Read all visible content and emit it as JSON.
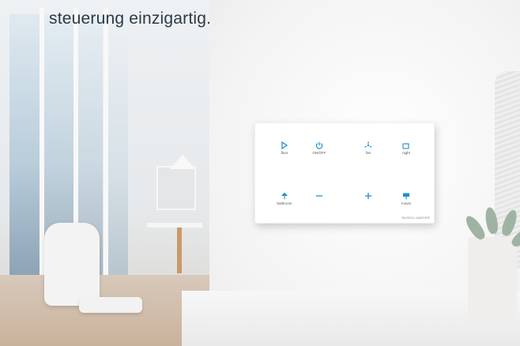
{
  "caption": {
    "line": "steuerung einzigartig."
  },
  "panel": {
    "brand": "BUSCH-JAEGER",
    "keys": [
      {
        "name": "floor-key",
        "icon": "floor-lamp-icon",
        "label": "floor"
      },
      {
        "name": "onoff-key",
        "icon": "power-icon",
        "label": "ON/OFF"
      },
      {
        "name": "fan-key",
        "icon": "fan-icon",
        "label": "fan"
      },
      {
        "name": "night-key",
        "icon": "night-icon",
        "label": "night"
      },
      {
        "name": "bathroom-key",
        "icon": "bathroom-icon",
        "label": "bathroom"
      },
      {
        "name": "minus-key",
        "icon": "minus-icon",
        "label": ""
      },
      {
        "name": "plus-key",
        "icon": "plus-icon",
        "label": ""
      },
      {
        "name": "movie-key",
        "icon": "movie-icon",
        "label": "movie"
      }
    ]
  },
  "colors": {
    "icon": "#1f8fd0",
    "caption": "#2c3a45"
  }
}
